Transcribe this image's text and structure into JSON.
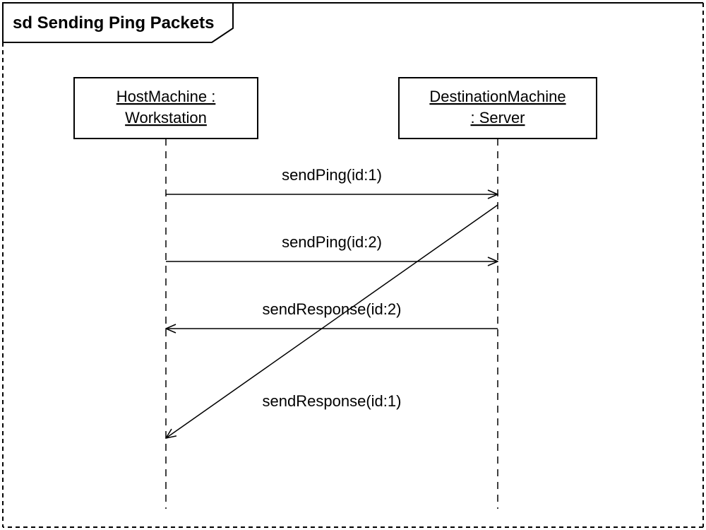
{
  "diagram": {
    "title": "sd Sending Ping Packets",
    "participants": {
      "left": {
        "line1": "HostMachine :",
        "line2": "Workstation"
      },
      "right": {
        "line1": "DestinationMachine",
        "line2": ": Server"
      }
    },
    "messages": {
      "m1": "sendPing(id:1)",
      "m2": "sendPing(id:2)",
      "m3": "sendResponse(id:2)",
      "m4": "sendResponse(id:1)"
    }
  }
}
